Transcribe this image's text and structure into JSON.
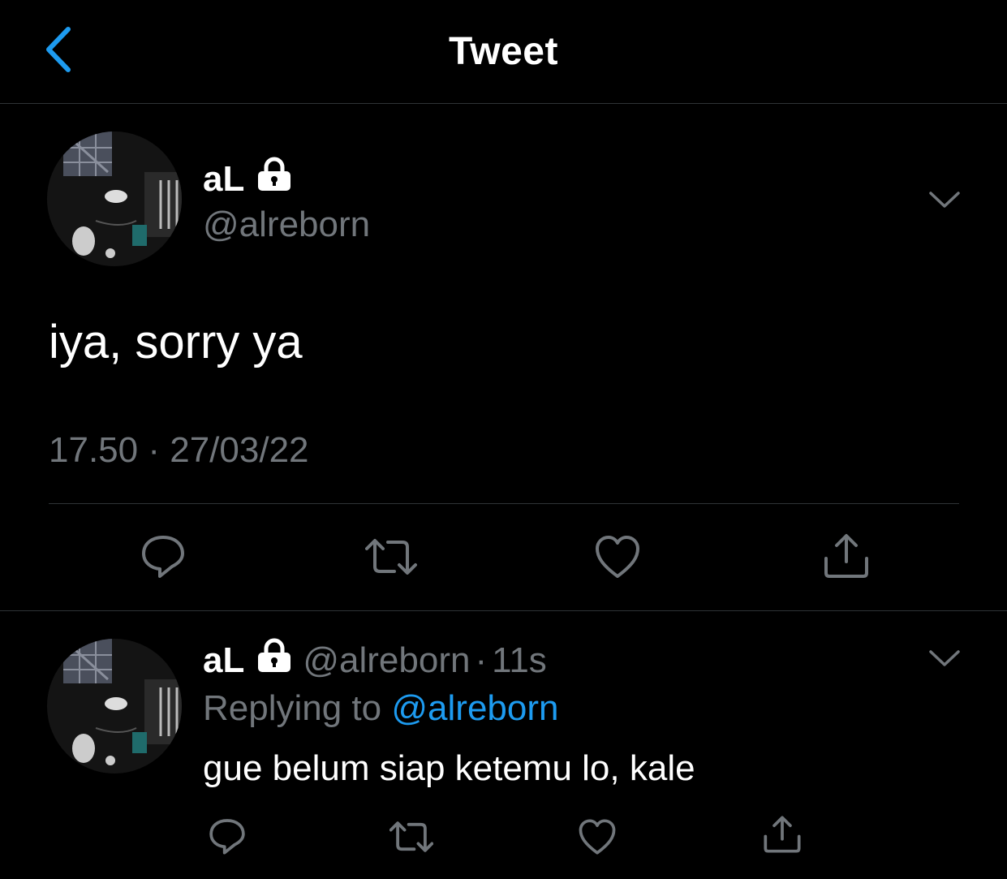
{
  "nav": {
    "title": "Tweet",
    "back_icon": "chevron-left-icon",
    "accent_color": "#1d9bf0"
  },
  "tweet": {
    "display_name": "aL",
    "handle": "@alreborn",
    "protected_icon": "lock-icon",
    "text": "iya, sorry ya",
    "time": "17.50",
    "separator": "·",
    "date": "27/03/22",
    "menu_icon": "chevron-down-icon",
    "actions": [
      "reply-icon",
      "retweet-icon",
      "like-icon",
      "share-icon"
    ]
  },
  "reply": {
    "display_name": "aL",
    "handle": "@alreborn",
    "separator": "·",
    "age": "11s",
    "replying_prefix": "Replying to",
    "replying_to": "@alreborn",
    "text": "gue belum siap ketemu lo, kale",
    "menu_icon": "chevron-down-icon",
    "actions": [
      "reply-icon",
      "retweet-icon",
      "like-icon",
      "share-icon"
    ]
  },
  "colors": {
    "background": "#000000",
    "primary_text": "#ffffff",
    "secondary_text": "#71767b",
    "link": "#1d9bf0",
    "divider": "#2f3336"
  }
}
